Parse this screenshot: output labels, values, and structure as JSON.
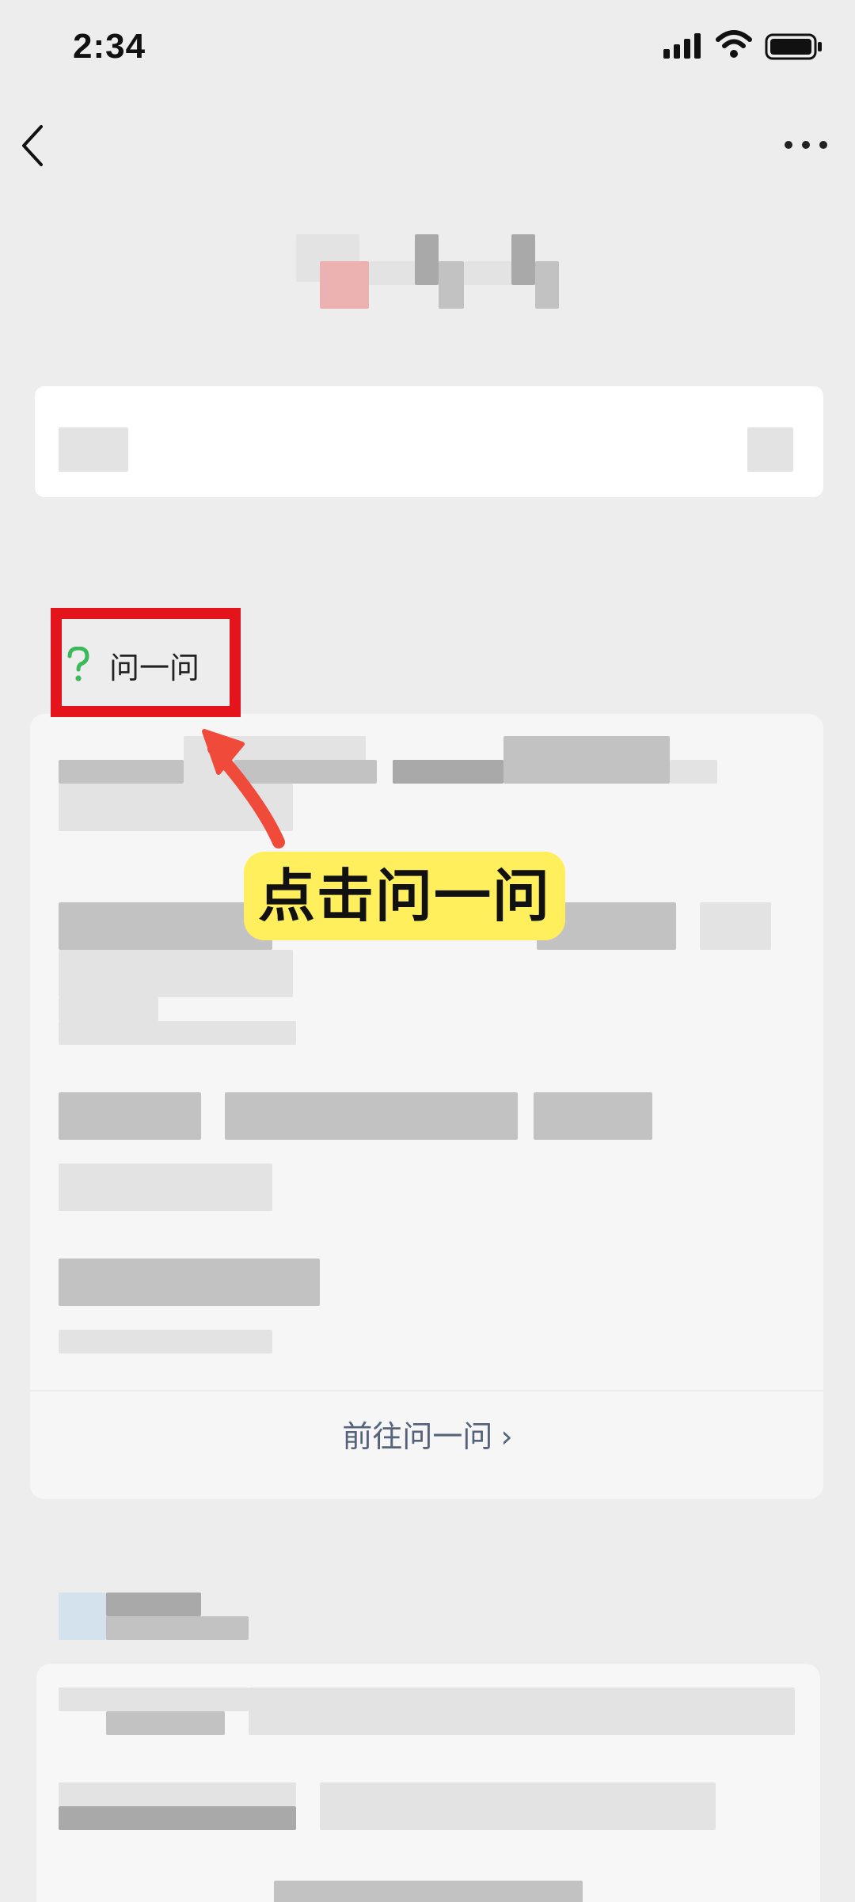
{
  "status_bar": {
    "time": "2:34",
    "icons": [
      "signal-icon",
      "wifi-icon",
      "battery-icon"
    ]
  },
  "nav": {
    "back_icon": "back-chevron-icon",
    "more_icon": "more-dots-icon"
  },
  "ask_section": {
    "icon": "question-icon",
    "title": "问一问",
    "goto_label": "前往问一问",
    "goto_chevron": "›"
  },
  "annotation": {
    "label": "点击问一问",
    "highlight_color": "#e3141b",
    "label_bg": "#ffef5c",
    "arrow_color": "#f04a3a"
  },
  "colors": {
    "page_bg": "#ededed",
    "card_bg": "#f6f6f6",
    "accent_green": "#3cb95a",
    "link_color": "#56627a"
  }
}
